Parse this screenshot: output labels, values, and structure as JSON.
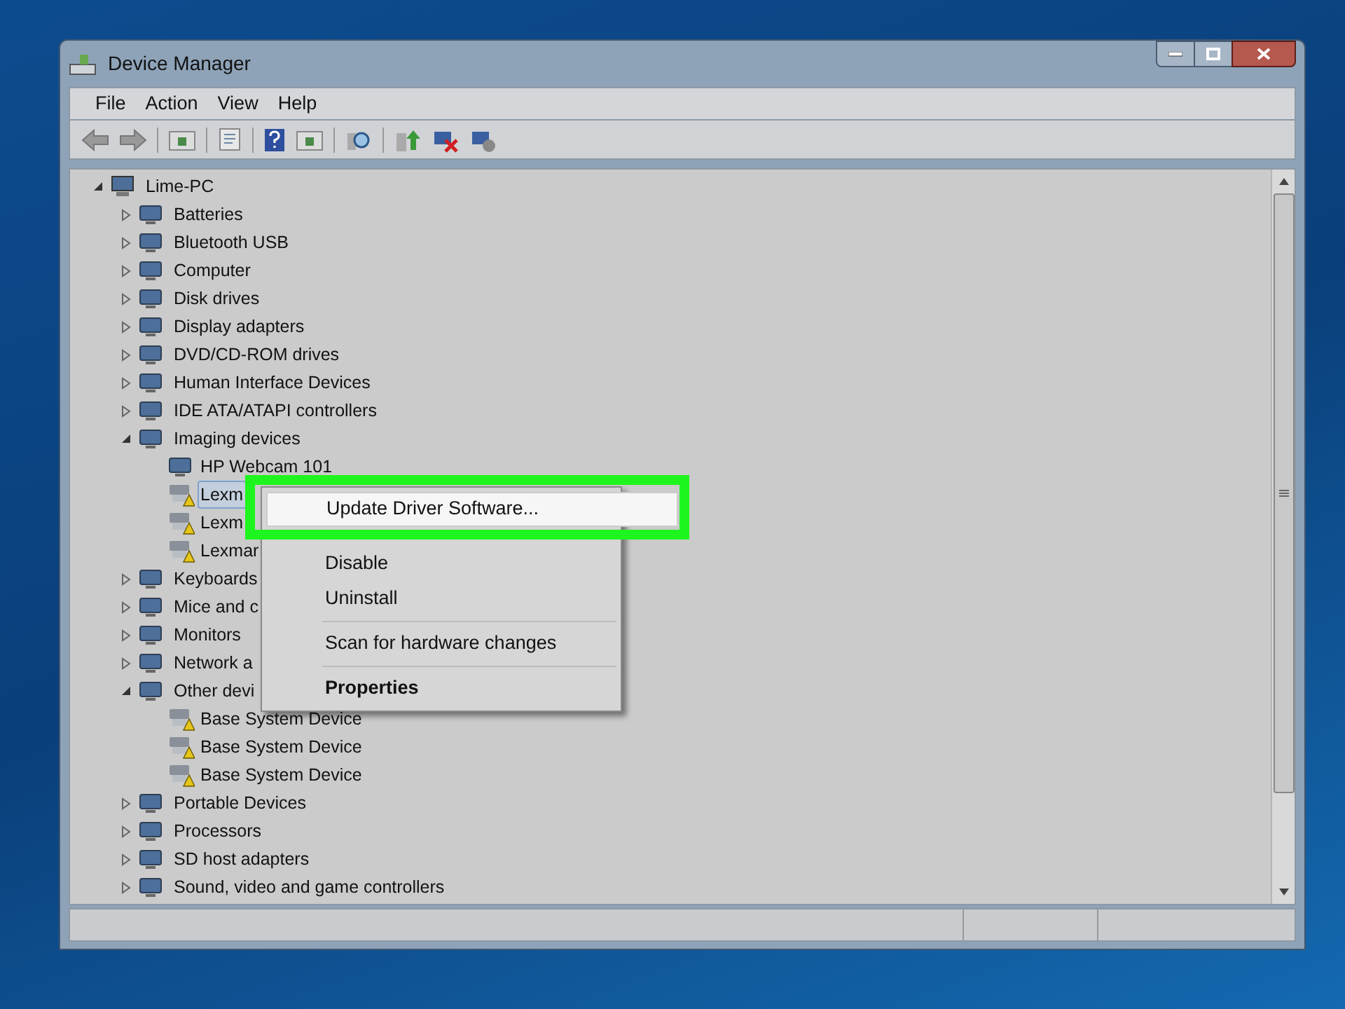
{
  "window": {
    "title": "Device Manager"
  },
  "menu_bar": [
    "File",
    "Action",
    "View",
    "Help"
  ],
  "tree": {
    "label": "Lime-PC",
    "expanded": true,
    "selected": false,
    "children": [
      {
        "label": "Batteries",
        "expanded": false,
        "selected": false,
        "warning": false
      },
      {
        "label": "Bluetooth USB",
        "expanded": false,
        "selected": false,
        "warning": false
      },
      {
        "label": "Computer",
        "expanded": false,
        "selected": false,
        "warning": false
      },
      {
        "label": "Disk drives",
        "expanded": false,
        "selected": false,
        "warning": false
      },
      {
        "label": "Display adapters",
        "expanded": false,
        "selected": false,
        "warning": false
      },
      {
        "label": "DVD/CD-ROM drives",
        "expanded": false,
        "selected": false,
        "warning": false
      },
      {
        "label": "Human Interface Devices",
        "expanded": false,
        "selected": false,
        "warning": false
      },
      {
        "label": "IDE ATA/ATAPI controllers",
        "expanded": false,
        "selected": false,
        "warning": false
      },
      {
        "label": "Imaging devices",
        "expanded": true,
        "selected": false,
        "warning": false,
        "children": [
          {
            "label": "HP Webcam 101",
            "selected": false,
            "warning": false
          },
          {
            "label": "Lexm",
            "selected": true,
            "warning": true
          },
          {
            "label": "Lexm",
            "selected": false,
            "warning": true
          },
          {
            "label": "Lexmar",
            "selected": false,
            "warning": true
          }
        ]
      },
      {
        "label": "Keyboards",
        "expanded": false,
        "selected": false,
        "warning": false
      },
      {
        "label": "Mice and c",
        "expanded": false,
        "selected": false,
        "warning": false
      },
      {
        "label": "Monitors",
        "expanded": false,
        "selected": false,
        "warning": false
      },
      {
        "label": "Network a",
        "expanded": false,
        "selected": false,
        "warning": false
      },
      {
        "label": "Other devi",
        "expanded": true,
        "selected": false,
        "warning": false,
        "children": [
          {
            "label": "Base System Device",
            "selected": false,
            "warning": true
          },
          {
            "label": "Base System Device",
            "selected": false,
            "warning": true
          },
          {
            "label": "Base System Device",
            "selected": false,
            "warning": true
          }
        ]
      },
      {
        "label": "Portable Devices",
        "expanded": false,
        "selected": false,
        "warning": false
      },
      {
        "label": "Processors",
        "expanded": false,
        "selected": false,
        "warning": false
      },
      {
        "label": "SD host adapters",
        "expanded": false,
        "selected": false,
        "warning": false
      },
      {
        "label": "Sound, video and game controllers",
        "expanded": false,
        "selected": false,
        "warning": false
      }
    ]
  },
  "context_menu": {
    "groups": [
      [
        {
          "label": "Update Driver Software...",
          "selected": true,
          "default": false
        },
        {
          "label": "Disable",
          "selected": false,
          "default": false
        },
        {
          "label": "Uninstall",
          "selected": false,
          "default": false
        }
      ],
      [
        {
          "label": "Scan for hardware changes",
          "selected": false,
          "default": false
        }
      ],
      [
        {
          "label": "Properties",
          "selected": false,
          "default": true
        }
      ]
    ]
  }
}
